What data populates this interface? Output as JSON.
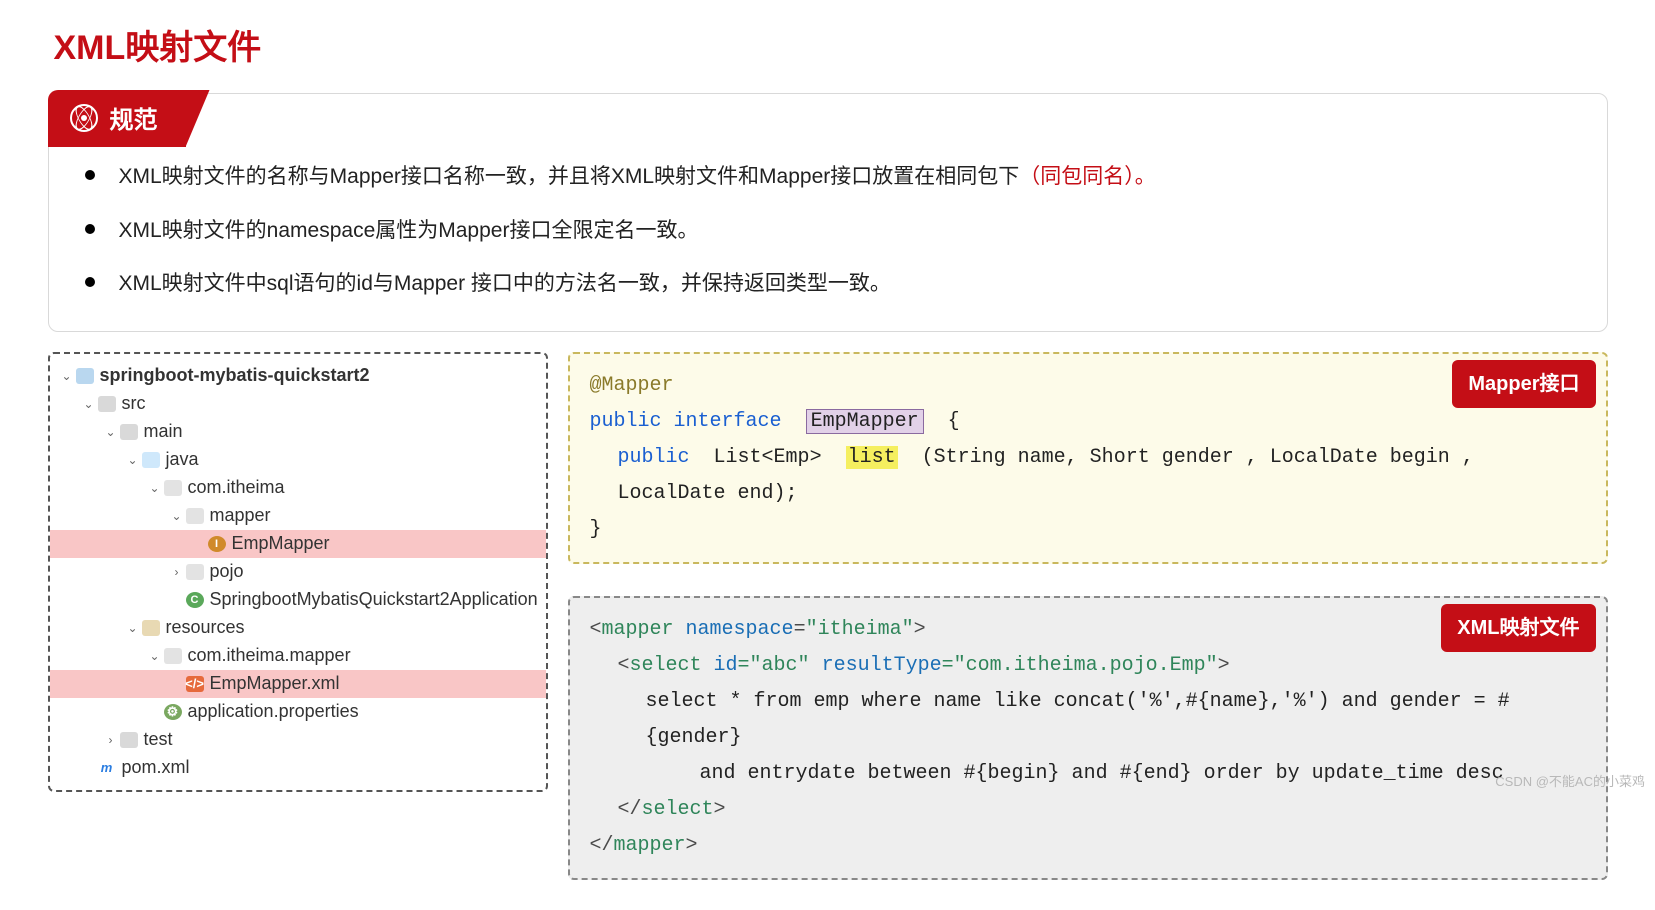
{
  "title": "XML映射文件",
  "spec": {
    "tab_label": "规范",
    "rules": [
      {
        "text": "XML映射文件的名称与Mapper接口名称一致，并且将XML映射文件和Mapper接口放置在相同包下",
        "red_suffix": "（同包同名）。"
      },
      {
        "text": "XML映射文件的namespace属性为Mapper接口全限定名一致。"
      },
      {
        "text": "XML映射文件中sql语句的id与Mapper 接口中的方法名一致，并保持返回类型一致。"
      }
    ]
  },
  "tree": [
    {
      "depth": 0,
      "arrow": "open",
      "icon": "proj",
      "label": "springboot-mybatis-quickstart2",
      "bold": true
    },
    {
      "depth": 1,
      "arrow": "open",
      "icon": "fold",
      "label": "src"
    },
    {
      "depth": 2,
      "arrow": "open",
      "icon": "fold",
      "label": "main"
    },
    {
      "depth": 3,
      "arrow": "open",
      "icon": "java",
      "label": "java"
    },
    {
      "depth": 4,
      "arrow": "open",
      "icon": "pkg",
      "label": "com.itheima"
    },
    {
      "depth": 5,
      "arrow": "open",
      "icon": "pkg",
      "label": "mapper"
    },
    {
      "depth": 6,
      "arrow": "none",
      "icon": "iface",
      "label": "EmpMapper",
      "hl": true
    },
    {
      "depth": 5,
      "arrow": "closed",
      "icon": "pkg",
      "label": "pojo"
    },
    {
      "depth": 5,
      "arrow": "none",
      "icon": "class",
      "label": "SpringbootMybatisQuickstart2Application"
    },
    {
      "depth": 3,
      "arrow": "open",
      "icon": "res",
      "label": "resources"
    },
    {
      "depth": 4,
      "arrow": "open",
      "icon": "pkg",
      "label": "com.itheima.mapper"
    },
    {
      "depth": 5,
      "arrow": "none",
      "icon": "xml",
      "label": "EmpMapper.xml",
      "hl": true
    },
    {
      "depth": 4,
      "arrow": "none",
      "icon": "prop",
      "label": "application.properties"
    },
    {
      "depth": 2,
      "arrow": "closed",
      "icon": "fold",
      "label": "test"
    },
    {
      "depth": 1,
      "arrow": "none",
      "icon": "mvn",
      "label": "pom.xml"
    }
  ],
  "mapper_code": {
    "badge": "Mapper接口",
    "line1_anno": "@Mapper",
    "line2_pre": "public interface",
    "line2_hl": "EmpMapper",
    "line2_post": "{",
    "line3_kw": "public",
    "line3_type": "List<Emp>",
    "line3_hl": "list",
    "line3_rest": "(String name, Short gender , LocalDate begin , LocalDate end);",
    "line4": "}"
  },
  "xml_code": {
    "badge": "XML映射文件",
    "l1": {
      "open": "<",
      "tag": "mapper",
      "attr": " namespace",
      "eq": "=",
      "val": "\"itheima\"",
      "close": ">"
    },
    "l2": {
      "open": "<",
      "tag": "select",
      "attr1": " id",
      "val1": "=\"abc\"",
      "attr2": " resultType",
      "val2": "=\"com.itheima.pojo.Emp\"",
      "close": ">"
    },
    "l3": "select * from emp where name like concat('%',#{name},'%') and gender = #{gender}",
    "l4": "and entrydate between #{begin} and #{end} order by update_time desc",
    "l5": {
      "open": "</",
      "tag": "select",
      "close": ">"
    },
    "l6": {
      "open": "</",
      "tag": "mapper",
      "close": ">"
    }
  },
  "watermark": "CSDN @不能AC的小菜鸡"
}
